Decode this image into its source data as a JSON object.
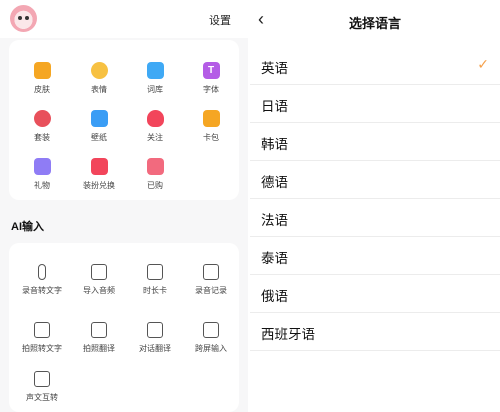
{
  "left": {
    "settings_label": "设置",
    "grid": [
      {
        "label": "皮肤",
        "icon": "tshirt-icon"
      },
      {
        "label": "表情",
        "icon": "emoji-icon"
      },
      {
        "label": "词库",
        "icon": "dictionary-icon"
      },
      {
        "label": "字体",
        "icon": "font-icon",
        "glyph": "T"
      },
      {
        "label": "套装",
        "icon": "suit-pack-icon"
      },
      {
        "label": "壁纸",
        "icon": "wallpaper-icon"
      },
      {
        "label": "关注",
        "icon": "heart-icon"
      },
      {
        "label": "卡包",
        "icon": "card-wallet-icon"
      },
      {
        "label": "礼物",
        "icon": "gift-icon"
      },
      {
        "label": "装扮兑换",
        "icon": "exchange-icon"
      },
      {
        "label": "已购",
        "icon": "shopping-bag-icon"
      }
    ],
    "ai_title": "AI输入",
    "ai_items": [
      {
        "label": "录音转文字",
        "icon": "microphone-icon"
      },
      {
        "label": "导入音频",
        "icon": "audio-folder-icon"
      },
      {
        "label": "时长卡",
        "icon": "clock-card-icon"
      },
      {
        "label": "录音记录",
        "icon": "record-list-icon"
      },
      {
        "label": "拍照转文字",
        "icon": "scan-text-icon"
      },
      {
        "label": "拍照翻译",
        "icon": "camera-translate-icon"
      },
      {
        "label": "对话翻译",
        "icon": "dialogue-translate-icon"
      },
      {
        "label": "跨屏输入",
        "icon": "cross-screen-icon"
      },
      {
        "label": "声文互转",
        "icon": "voice-text-icon"
      }
    ]
  },
  "right": {
    "title": "选择语言",
    "languages": [
      "英语",
      "日语",
      "韩语",
      "德语",
      "法语",
      "泰语",
      "俄语",
      "西班牙语"
    ],
    "selected_index": 0,
    "accent_color": "#f5a04a"
  }
}
